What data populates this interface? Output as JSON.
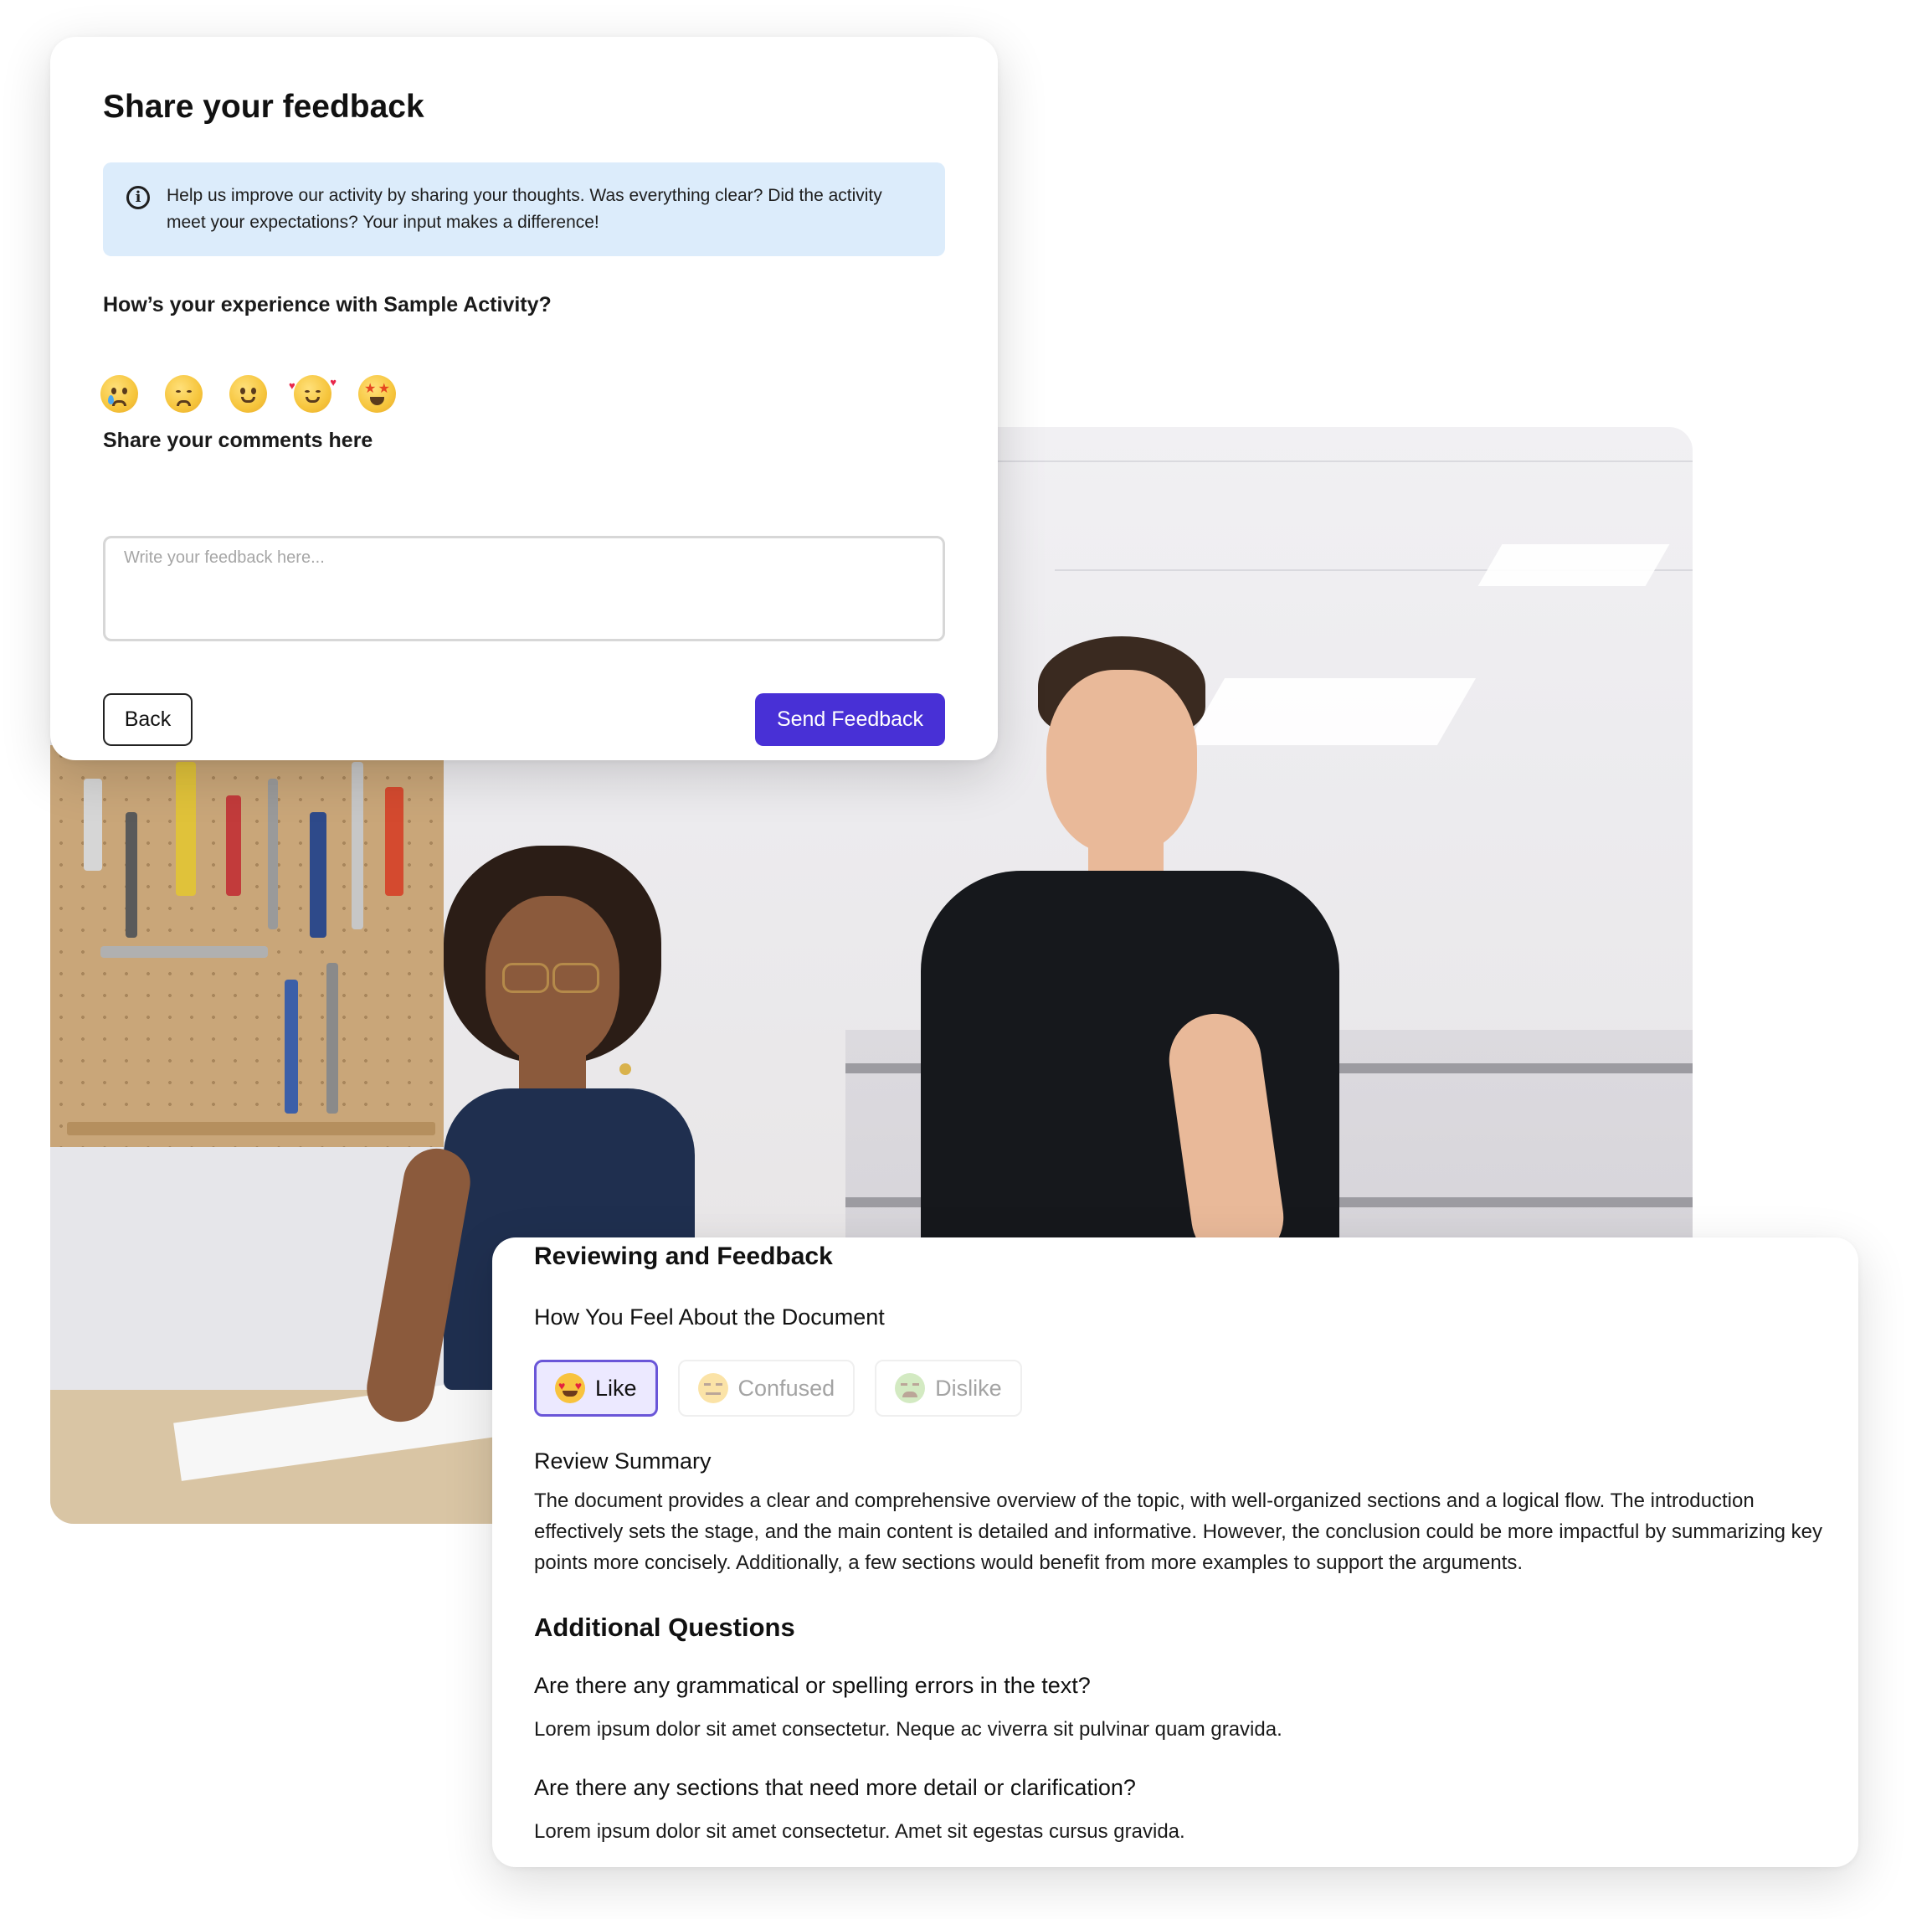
{
  "feedback_card": {
    "title": "Share your feedback",
    "info_text": "Help us improve our activity by sharing your thoughts. Was everything clear? Did the activity meet your expectations? Your input makes a difference!",
    "experience_question": "How’s your experience with Sample Activity?",
    "emoji_options": [
      "crying-face",
      "pensive-face",
      "slightly-smiling-face",
      "smiling-face-with-hearts",
      "star-struck-face"
    ],
    "comments_label": "Share your comments here",
    "comments_placeholder": "Write your feedback here...",
    "comments_value": "",
    "back_label": "Back",
    "send_label": "Send Feedback",
    "accent_color": "#4830d6",
    "info_bg_color": "#dcecfb"
  },
  "review_card": {
    "title": "Reviewing and Feedback",
    "feel_label": "How You Feel About the Document",
    "reactions": [
      {
        "label": "Like",
        "icon": "heart-eyes-face-icon",
        "selected": true
      },
      {
        "label": "Confused",
        "icon": "confused-face-icon",
        "selected": false
      },
      {
        "label": "Dislike",
        "icon": "disappointed-face-icon",
        "selected": false
      }
    ],
    "summary_label": "Review Summary",
    "summary_text": "The document provides a clear and comprehensive overview of the topic, with well-organized sections and a logical flow. The introduction effectively sets the stage, and the main content is detailed and informative. However, the conclusion could be more impactful by summarizing key points more concisely. Additionally, a few sections would benefit from more examples to support the arguments.",
    "additional_title": "Additional Questions",
    "questions": [
      {
        "q": "Are there any grammatical or spelling errors in the text?",
        "a": "Lorem ipsum dolor sit amet consectetur. Neque ac viverra sit pulvinar quam gravida."
      },
      {
        "q": "Are there any sections that need more detail or clarification?",
        "a": "Lorem ipsum dolor sit amet consectetur. Amet sit egestas cursus gravida."
      }
    ],
    "selected_color": "#6a56d8"
  },
  "background_photo": {
    "subject": "two-people-in-workshop-photo"
  }
}
